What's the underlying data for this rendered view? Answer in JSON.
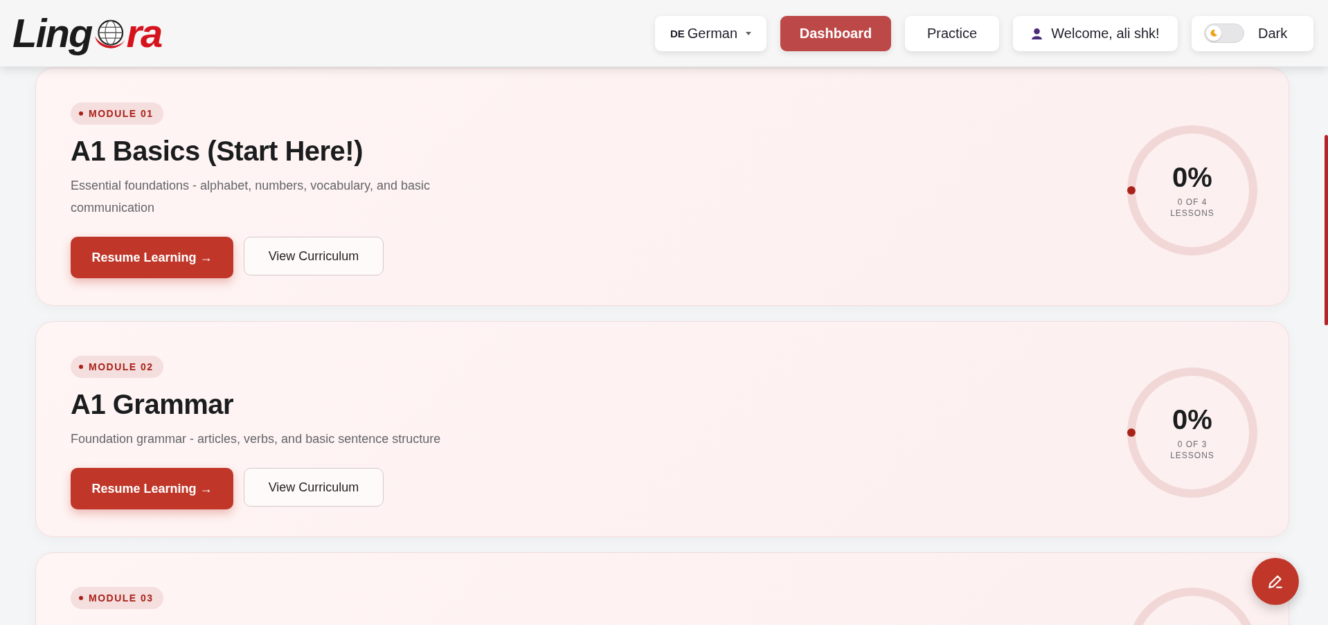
{
  "logo": {
    "text_start": "Ling",
    "text_end": "ra"
  },
  "nav": {
    "language": {
      "code": "DE",
      "label": "German"
    },
    "tabs": [
      {
        "label": "Dashboard",
        "selected": true
      },
      {
        "label": "Practice",
        "selected": false
      }
    ],
    "user": {
      "greeting": "Welcome, ali shk!"
    },
    "theme_toggle": {
      "label": "Dark",
      "on": false
    }
  },
  "modules": [
    {
      "badge": "MODULE 01",
      "title": "A1 Basics (Start Here!)",
      "description": "Essential foundations - alphabet, numbers, vocabulary, and basic communication",
      "primary_action": "Resume Learning →",
      "secondary_action": "View Curriculum",
      "progress": {
        "percent": "0%",
        "level": 0,
        "lessons": "0 OF 4 LESSONS"
      }
    },
    {
      "badge": "MODULE 02",
      "title": "A1 Grammar",
      "description": "Foundation grammar - articles, verbs, and basic sentence structure",
      "primary_action": "Resume Learning →",
      "secondary_action": "View Curriculum",
      "progress": {
        "percent": "0%",
        "level": 0,
        "lessons": "0 OF 3 LESSONS"
      }
    },
    {
      "badge": "MODULE 03"
    }
  ]
}
